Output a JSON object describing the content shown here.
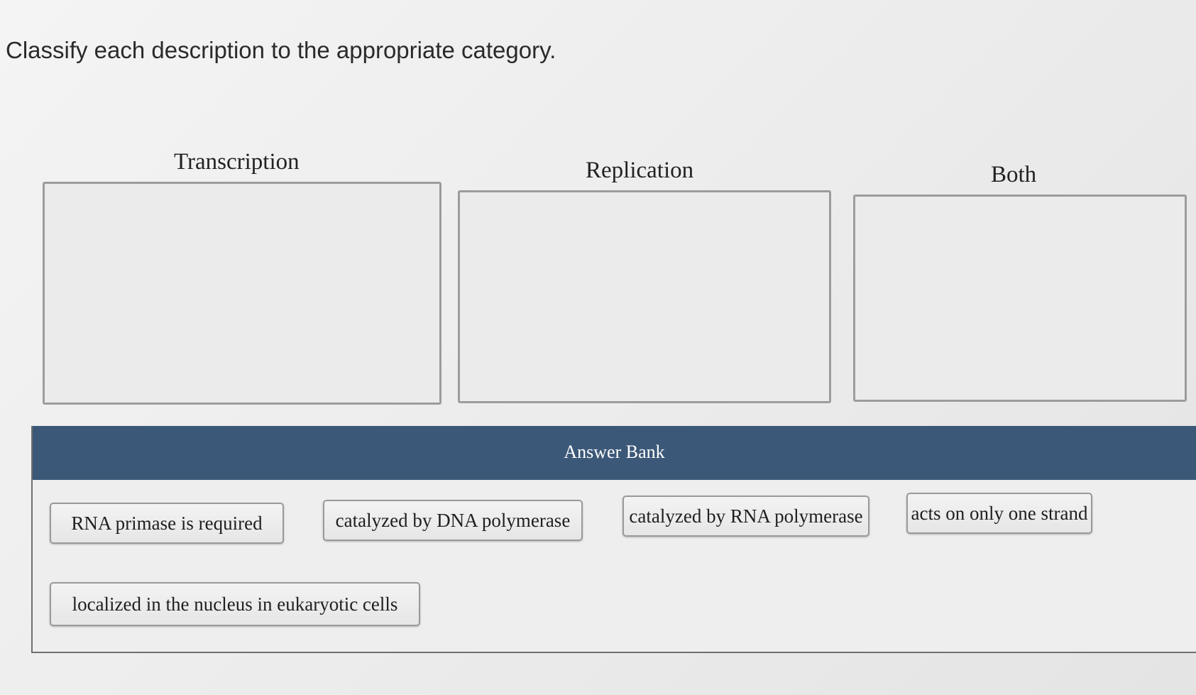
{
  "question": {
    "prompt": "Classify each description to the appropriate category."
  },
  "categories": [
    {
      "label": "Transcription"
    },
    {
      "label": "Replication"
    },
    {
      "label": "Both"
    }
  ],
  "answer_bank": {
    "title": "Answer Bank",
    "items": [
      {
        "label": "RNA primase is required"
      },
      {
        "label": "catalyzed by DNA polymerase"
      },
      {
        "label": "catalyzed by RNA polymerase"
      },
      {
        "label": "acts on only one strand"
      },
      {
        "label": "localized in the nucleus in eukaryotic cells"
      }
    ]
  }
}
